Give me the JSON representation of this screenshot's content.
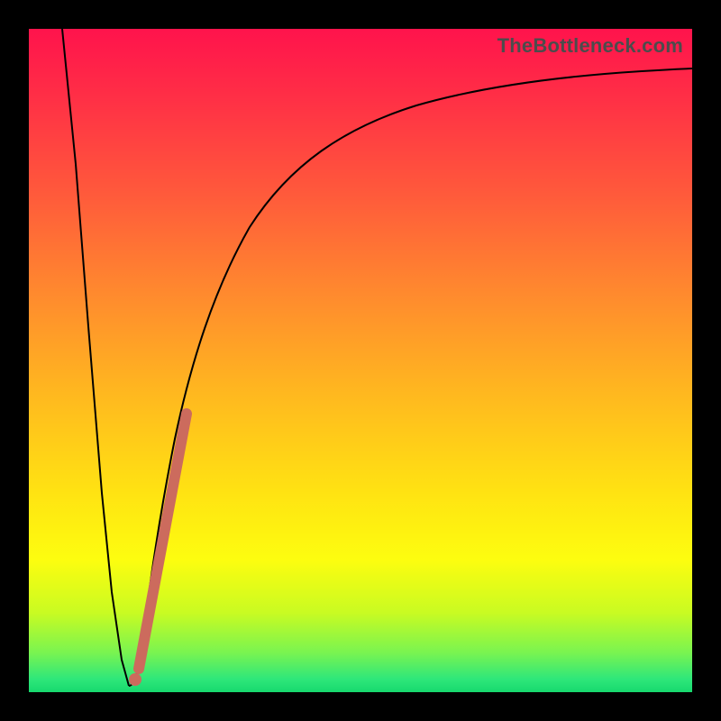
{
  "watermark": "TheBottleneck.com",
  "chart_data": {
    "type": "line",
    "title": "",
    "xlabel": "",
    "ylabel": "",
    "xlim": [
      0,
      100
    ],
    "ylim": [
      0,
      100
    ],
    "grid": false,
    "legend": false,
    "series": [
      {
        "name": "curve-left-descent",
        "x": [
          5,
          7,
          9,
          11,
          12.5,
          14,
          15
        ],
        "y": [
          100,
          80,
          55,
          30,
          15,
          5,
          1
        ]
      },
      {
        "name": "curve-right-ascent",
        "x": [
          15,
          17,
          19,
          22,
          26,
          31,
          38,
          48,
          60,
          75,
          90,
          100
        ],
        "y": [
          1,
          8,
          20,
          38,
          55,
          68,
          78,
          85,
          89,
          91.5,
          93,
          94
        ]
      },
      {
        "name": "highlight-segment",
        "x": [
          16.5,
          23.5
        ],
        "y": [
          3.5,
          42
        ]
      },
      {
        "name": "highlight-dot",
        "x": [
          16
        ],
        "y": [
          2
        ]
      }
    ]
  },
  "colors": {
    "curve": "#000000",
    "highlight": "#cc6b5d",
    "frame": "#000000"
  }
}
